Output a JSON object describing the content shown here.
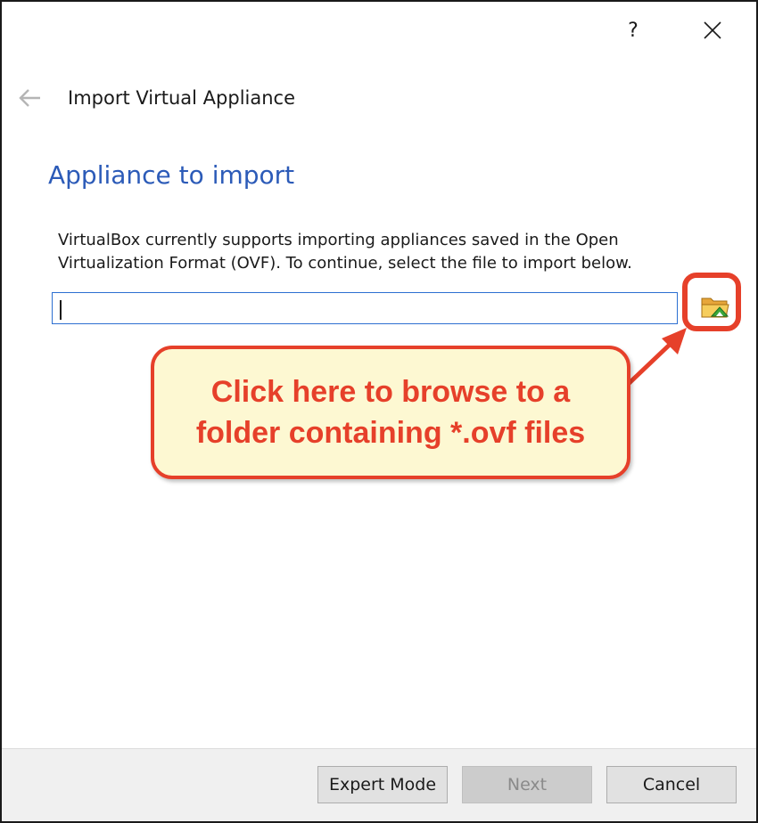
{
  "titlebar": {
    "help_label": "?",
    "close_icon": "close-icon"
  },
  "wizard": {
    "back_icon": "back-arrow-icon",
    "title": "Import Virtual Appliance"
  },
  "page": {
    "heading": "Appliance to import",
    "description": "VirtualBox currently supports importing appliances saved in the Open Virtualization Format (OVF). To continue, select the file to import below.",
    "file_input_value": "",
    "browse_icon": "folder-open-icon"
  },
  "annotation": {
    "callout_line1": "Click here to browse to a",
    "callout_line2": "folder containing *.ovf files",
    "color": "#e6402a",
    "fill": "#fdf8d2"
  },
  "footer": {
    "expert_label": "Expert Mode",
    "next_label": "Next",
    "cancel_label": "Cancel"
  },
  "colors": {
    "heading": "#2c5bb8",
    "input_border": "#2c6fd1"
  }
}
